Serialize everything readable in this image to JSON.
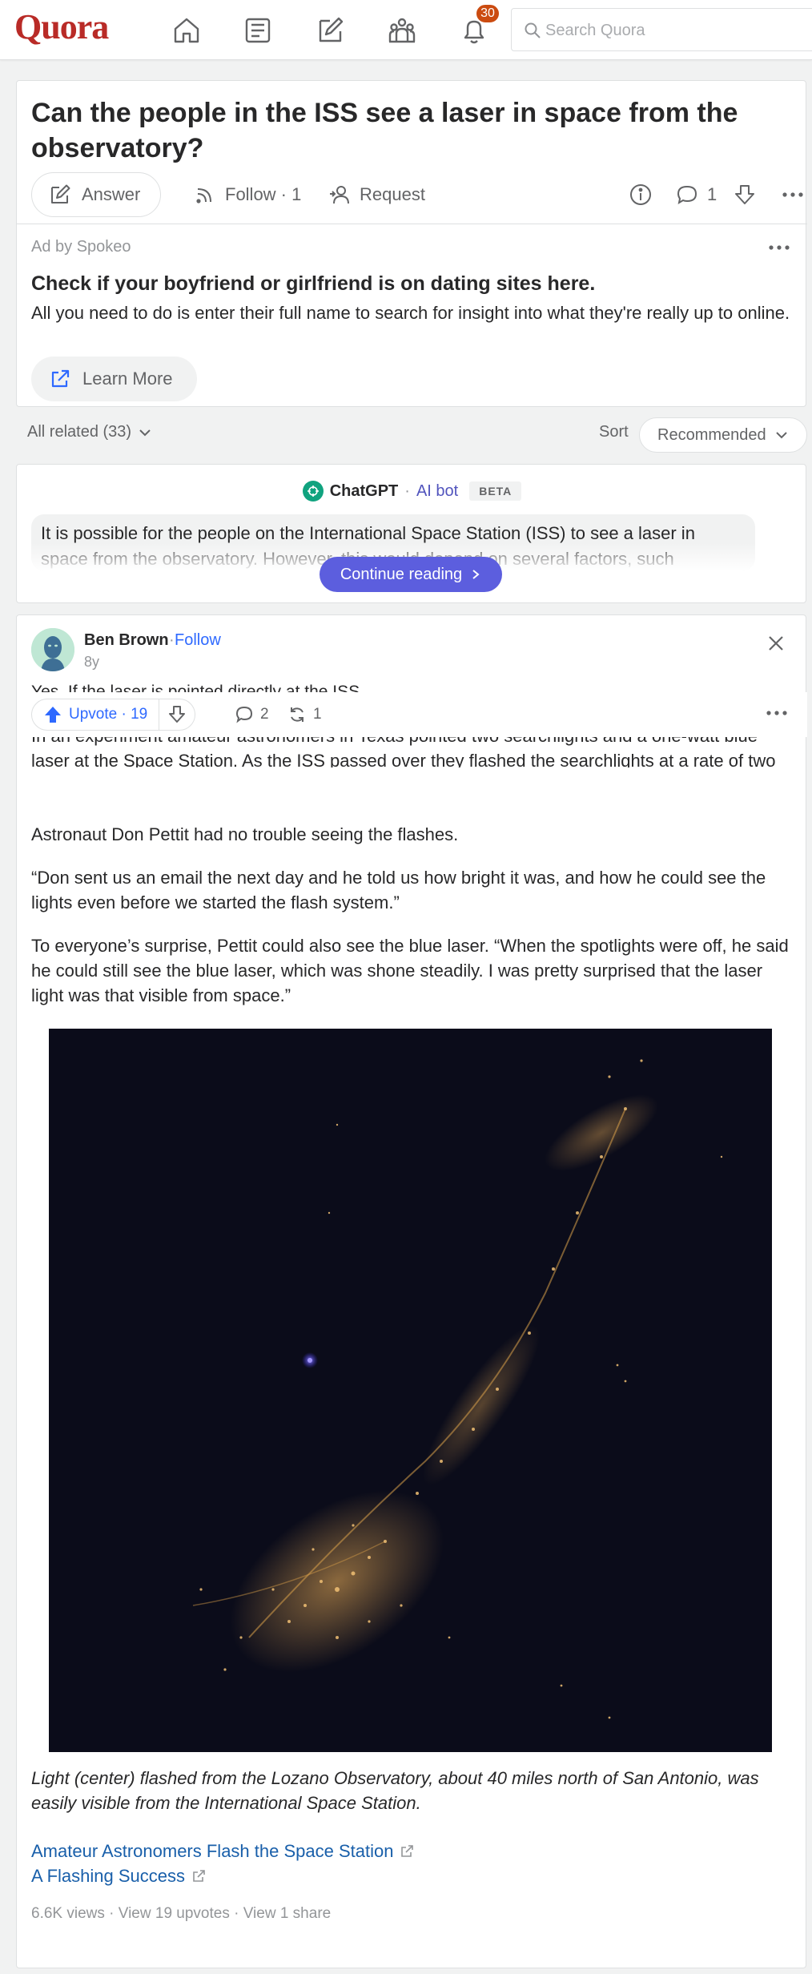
{
  "header": {
    "logo": "Quora",
    "notifications_count": "30",
    "search_placeholder": "Search Quora"
  },
  "question": {
    "title": "Can the people in the ISS see a laser in space from the observatory?",
    "answer_label": "Answer",
    "follow_label": "Follow · 1",
    "request_label": "Request",
    "comments_count": "1"
  },
  "ad": {
    "by": "Ad by Spokeo",
    "headline": "Check if your boyfriend or girlfriend is on dating sites here.",
    "body": "All you need to do is enter their full name to search for insight into what they're really up to online.",
    "cta": "Learn More"
  },
  "related": {
    "all_related": "All related (33)",
    "sort_label": "Sort",
    "sort_value": "Recommended"
  },
  "chatgpt": {
    "name": "ChatGPT",
    "separator": "·",
    "bot_label": "AI bot",
    "beta": "BETA",
    "text": "It is possible for the people on the International Space Station (ISS) to see a laser in space from the observatory. However, this would depend on several factors, such",
    "continue": "Continue reading"
  },
  "answer": {
    "author": "Ben Brown",
    "dot": "·",
    "follow": "Follow",
    "time": "8y",
    "partial_line": "Yes. If the laser is pointed directly at the ISS.",
    "upvote_label": "Upvote · 19",
    "comments": "2",
    "shares": "1",
    "p1": "In an experiment amateur astronomers in Texas pointed two searchlights and a one-watt blue laser at the Space Station. As the ISS passed over they flashed the searchlights at a rate of two seconds on, then two seconds off.",
    "p2": "Astronaut Don Pettit had no trouble seeing the flashes.",
    "p3": "“Don sent us an email the next day and he told us how bright it was, and how he could see the lights even before we started the flash system.”",
    "p4": "To everyone’s surprise, Pettit could also see the blue laser. “When the spotlights were off, he said he could still see the blue laser, which was shone steadily. I was pretty surprised that the laser light was that visible from space.”",
    "caption": "Light (center) flashed from the Lozano Observatory, about 40 miles north of San Antonio, was easily visible from the International Space Station.",
    "link1": "Amateur Astronomers Flash the Space Station",
    "link2": "A Flashing Success",
    "stats": "6.6K views · View 19 upvotes · View 1 share"
  },
  "colors": {
    "brand": "#b92b27",
    "link": "#195faa",
    "upvote": "#2e69ff",
    "ai_button": "#5c5ede"
  }
}
